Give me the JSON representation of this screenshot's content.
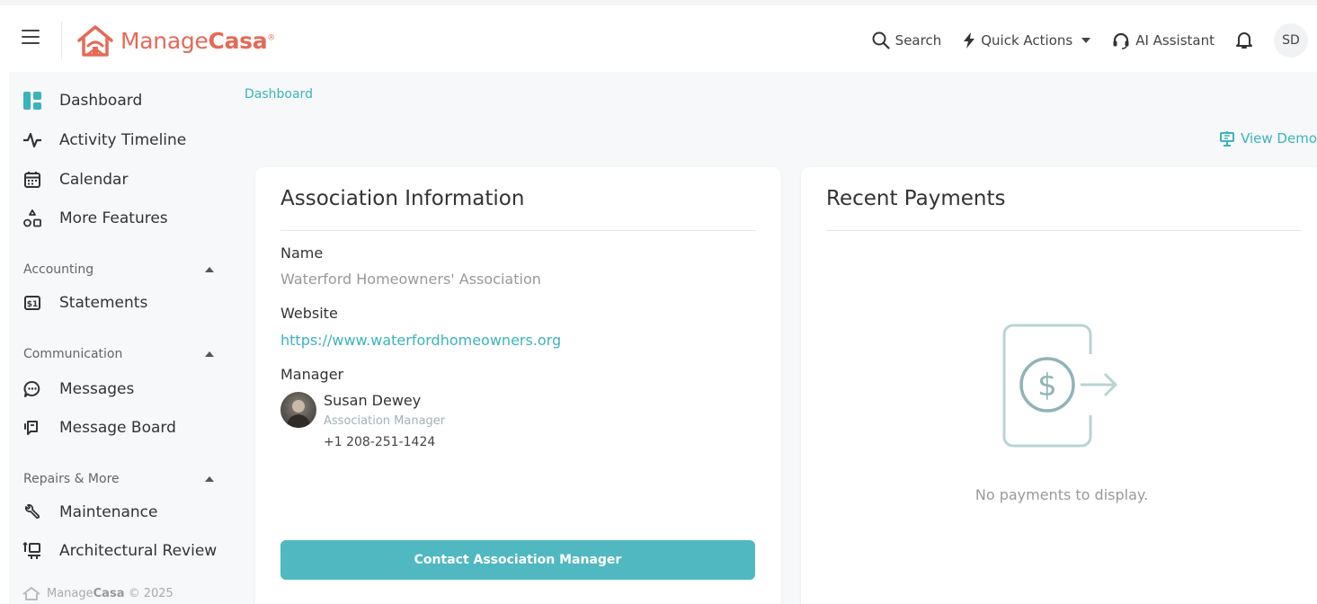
{
  "brand": {
    "name_light": "Manage",
    "name_bold": "Casa",
    "registered": "®",
    "color": "#e46a57"
  },
  "topbar": {
    "search_label": "Search",
    "quick_actions_label": "Quick Actions",
    "ai_assistant_label": "AI Assistant",
    "user_initials": "SD"
  },
  "sidebar": {
    "items_top": [
      {
        "label": "Dashboard",
        "icon": "dashboard-icon"
      },
      {
        "label": "Activity Timeline",
        "icon": "activity-icon"
      },
      {
        "label": "Calendar",
        "icon": "calendar-icon"
      },
      {
        "label": "More Features",
        "icon": "more-features-icon"
      }
    ],
    "sections": {
      "accounting": {
        "label": "Accounting",
        "items": [
          {
            "label": "Statements",
            "icon": "statements-icon"
          }
        ]
      },
      "communication": {
        "label": "Communication",
        "items": [
          {
            "label": "Messages",
            "icon": "messages-icon"
          },
          {
            "label": "Message Board",
            "icon": "message-board-icon"
          }
        ]
      },
      "repairs": {
        "label": "Repairs & More",
        "items": [
          {
            "label": "Maintenance",
            "icon": "maintenance-icon"
          },
          {
            "label": "Architectural Review",
            "icon": "architectural-review-icon"
          }
        ]
      }
    },
    "footer": {
      "name_light": "Manage",
      "name_bold": "Casa",
      "year": "© 2025"
    }
  },
  "main": {
    "breadcrumb": "Dashboard",
    "view_demo_label": "View Demo",
    "association": {
      "title": "Association Information",
      "name_label": "Name",
      "name_value": "Waterford Homeowners' Association",
      "website_label": "Website",
      "website_value": "https://www.waterfordhomeowners.org",
      "manager_label": "Manager",
      "manager_name": "Susan Dewey",
      "manager_role": "Association Manager",
      "manager_phone": "+1 208-251-1424",
      "contact_button": "Contact Association Manager"
    },
    "payments": {
      "title": "Recent Payments",
      "empty_text": "No payments to display."
    }
  },
  "colors": {
    "accent": "#3bb3bd",
    "button": "#4fb8c0",
    "sidebar_bg": "#f6f8f9"
  }
}
